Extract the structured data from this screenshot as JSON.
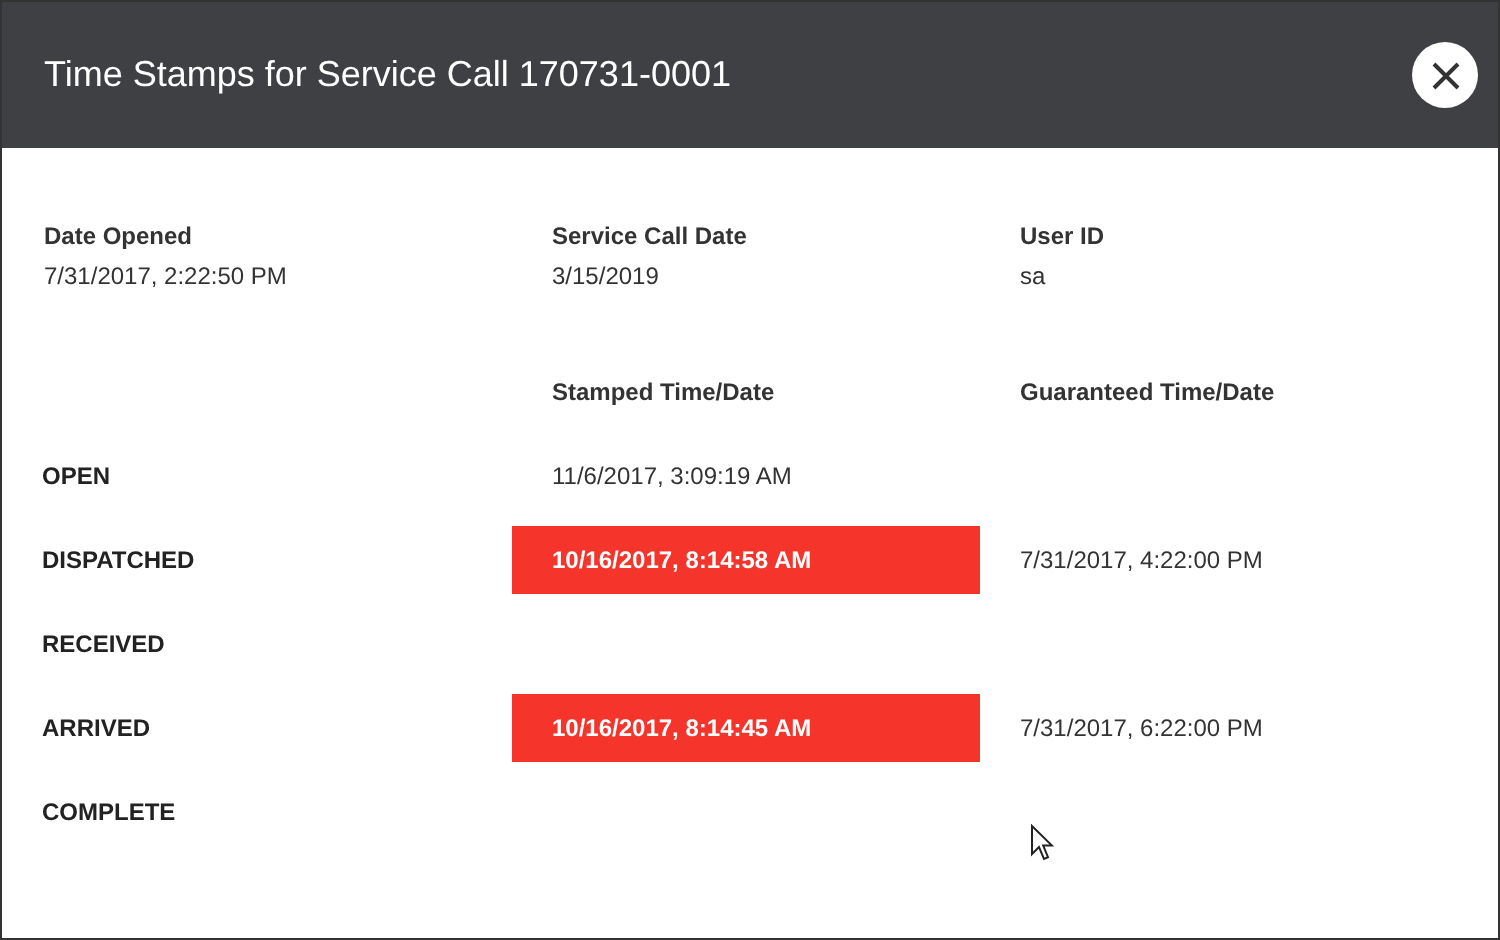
{
  "window": {
    "title": "Time Stamps for Service Call 170731-0001"
  },
  "info": [
    {
      "label": "Date Opened",
      "value": "7/31/2017, 2:22:50 PM"
    },
    {
      "label": "Service Call Date",
      "value": "3/15/2019"
    },
    {
      "label": "User ID",
      "value": "sa"
    }
  ],
  "table": {
    "columns": [
      "Stamped Time/Date",
      "Guaranteed Time/Date"
    ],
    "rows": [
      {
        "status": "OPEN",
        "stamped": "11/6/2017, 3:09:19 AM",
        "overdue": false
      },
      {
        "status": "DISPATCHED",
        "stamped": "10/16/2017, 8:14:58 AM",
        "guaranteed": "7/31/2017, 4:22:00 PM",
        "overdue": true
      },
      {
        "status": "RECEIVED"
      },
      {
        "status": "ARRIVED",
        "stamped": "10/16/2017, 8:14:45 AM",
        "guaranteed": "7/31/2017, 6:22:00 PM",
        "overdue": true
      },
      {
        "status": "COMPLETE"
      }
    ]
  }
}
